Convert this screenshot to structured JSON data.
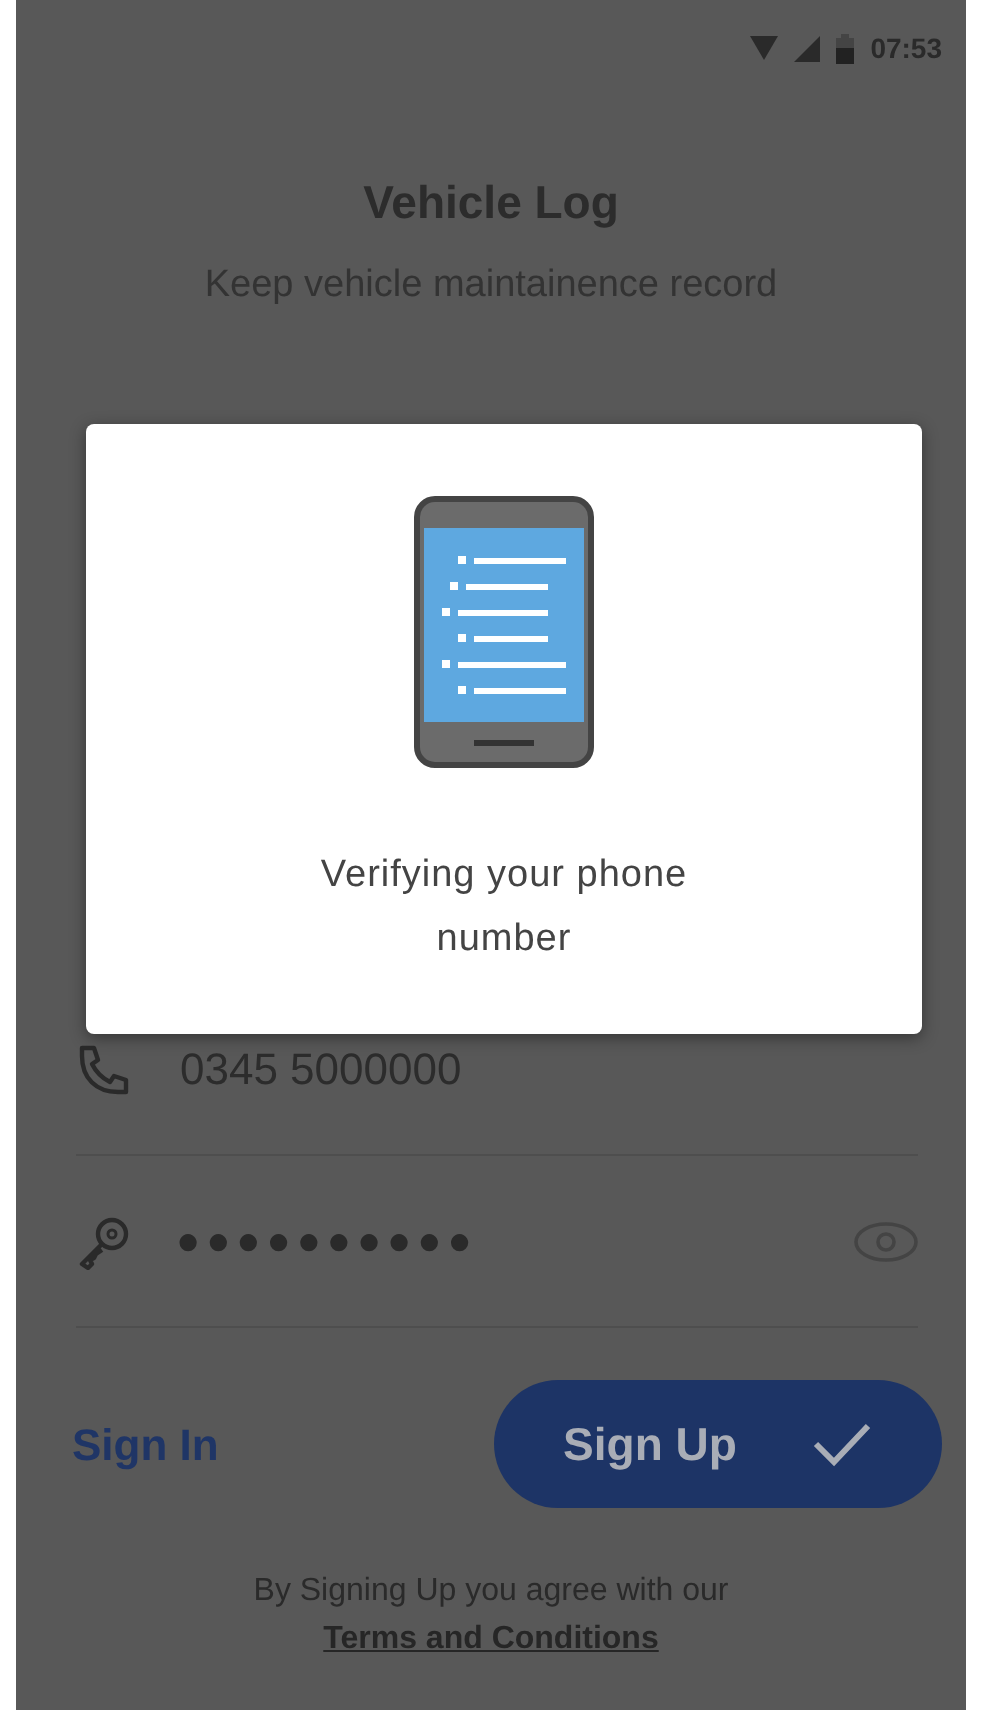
{
  "status_bar": {
    "time": "07:53"
  },
  "header": {
    "title": "Vehicle Log",
    "subtitle": "Keep vehicle maintainence record"
  },
  "phone_field": {
    "value": "0345 5000000"
  },
  "password_field": {
    "value": "●●●●●●●●●●"
  },
  "sign_in_link": "Sign In",
  "sign_up_button": "Sign Up",
  "footer": {
    "text": "By Signing Up you agree with our",
    "link": "Terms and Conditions"
  },
  "dialog": {
    "message": "Verifying your phone number"
  }
}
